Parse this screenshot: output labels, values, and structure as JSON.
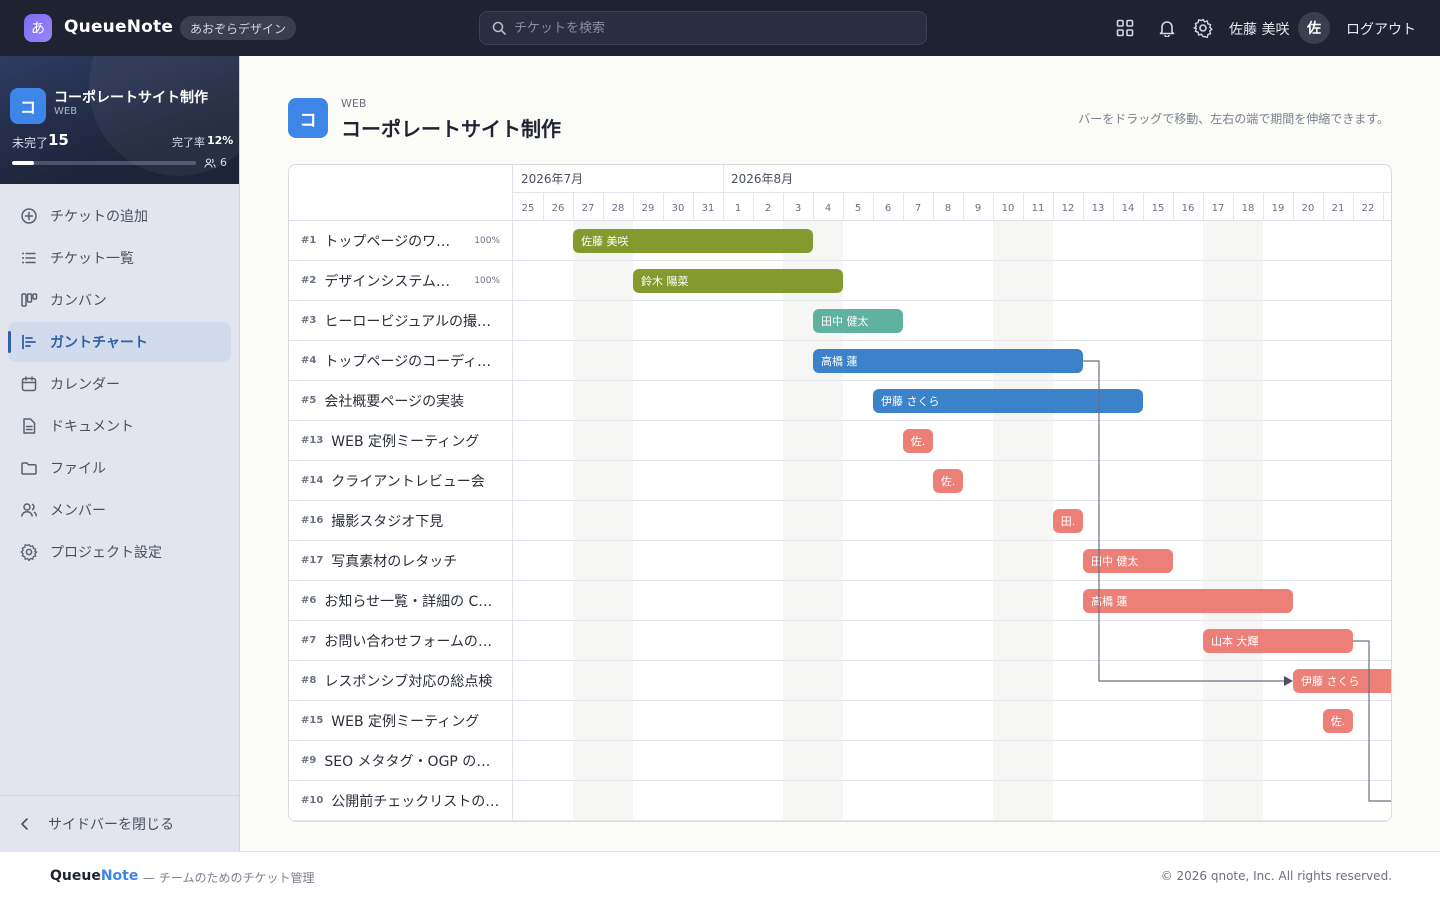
{
  "topbar": {
    "logo_glyph": "あ",
    "brand": "QueueNote",
    "org": "あおぞらデザイン",
    "search_placeholder": "チケットを検索",
    "user_name": "佐藤 美咲",
    "user_initial": "佐",
    "logout": "ログアウト",
    "icons": [
      "apps-grid-icon",
      "bell-icon",
      "gear-icon"
    ]
  },
  "project": {
    "icon": "コ",
    "name": "コーポレートサイト制作",
    "code": "WEB",
    "open_label": "未完了",
    "open_count": "15",
    "rate_label": "完了率",
    "rate": "12%",
    "progress": 0.12,
    "members": "6"
  },
  "nav": [
    {
      "label": "チケットの追加",
      "icon": "plus-circle-icon",
      "active": false
    },
    {
      "label": "チケット一覧",
      "icon": "list-icon",
      "active": false
    },
    {
      "label": "カンバン",
      "icon": "kanban-icon",
      "active": false
    },
    {
      "label": "ガントチャート",
      "icon": "gantt-icon",
      "active": true
    },
    {
      "label": "カレンダー",
      "icon": "calendar-icon",
      "active": false
    },
    {
      "label": "ドキュメント",
      "icon": "document-icon",
      "active": false
    },
    {
      "label": "ファイル",
      "icon": "folder-icon",
      "active": false
    },
    {
      "label": "メンバー",
      "icon": "users-icon",
      "active": false
    },
    {
      "label": "プロジェクト設定",
      "icon": "gear-icon",
      "active": false
    }
  ],
  "sidebar_close": "サイドバーを閉じる",
  "page": {
    "icon": "コ",
    "code": "WEB",
    "title": "コーポレートサイト制作",
    "hint": "バーをドラッグで移動、左右の端で期間を伸縮できます。"
  },
  "gantt": {
    "months": [
      {
        "label": "2026年7月",
        "start_index": 0
      },
      {
        "label": "2026年8月",
        "start_index": 7
      }
    ],
    "days": [
      "25",
      "26",
      "27",
      "28",
      "29",
      "30",
      "31",
      "1",
      "2",
      "3",
      "4",
      "5",
      "6",
      "7",
      "8",
      "9",
      "10",
      "11",
      "12",
      "13",
      "14",
      "15",
      "16",
      "17",
      "18",
      "19",
      "20",
      "21",
      "22"
    ],
    "weekend_indices": [
      2,
      9,
      16,
      23
    ],
    "tasks": [
      {
        "id": "#1",
        "name": "トップページのワイ…",
        "pct": "100%",
        "start": 2,
        "end": 10,
        "assignee": "佐藤 美咲",
        "color": "#849a2e"
      },
      {
        "id": "#2",
        "name": "デザインシステムの…",
        "pct": "100%",
        "start": 4,
        "end": 11,
        "assignee": "鈴木 陽菜",
        "color": "#849a2e"
      },
      {
        "id": "#3",
        "name": "ヒーロービジュアルの撮影…",
        "pct": "",
        "start": 10,
        "end": 13,
        "assignee": "田中 健太",
        "color": "#5fb2a0"
      },
      {
        "id": "#4",
        "name": "トップページのコーディン…",
        "pct": "",
        "start": 10,
        "end": 19,
        "assignee": "高橋 蓮",
        "color": "#3c82cb"
      },
      {
        "id": "#5",
        "name": "会社概要ページの実装",
        "pct": "",
        "start": 12,
        "end": 21,
        "assignee": "伊藤 さくら",
        "color": "#3c82cb"
      },
      {
        "id": "#13",
        "name": "WEB 定例ミーティング",
        "pct": "",
        "start": 13,
        "end": 14,
        "assignee": "佐.",
        "color": "#ec8078"
      },
      {
        "id": "#14",
        "name": "クライアントレビュー会",
        "pct": "",
        "start": 14,
        "end": 15,
        "assignee": "佐.",
        "color": "#ec8078"
      },
      {
        "id": "#16",
        "name": "撮影スタジオ下見",
        "pct": "",
        "start": 18,
        "end": 19,
        "assignee": "田.",
        "color": "#ec8078"
      },
      {
        "id": "#17",
        "name": "写真素材のレタッチ",
        "pct": "",
        "start": 19,
        "end": 22,
        "assignee": "田中 健太",
        "color": "#ec8078"
      },
      {
        "id": "#6",
        "name": "お知らせ一覧・詳細の CM…",
        "pct": "",
        "start": 19,
        "end": 26,
        "assignee": "高橋 蓮",
        "color": "#ec8078"
      },
      {
        "id": "#7",
        "name": "お問い合わせフォームの実…",
        "pct": "",
        "start": 23,
        "end": 28,
        "assignee": "山本 大輝",
        "color": "#ec8078"
      },
      {
        "id": "#8",
        "name": "レスポンシブ対応の総点検",
        "pct": "",
        "start": 26,
        "end": 30,
        "assignee": "伊藤 さくら",
        "color": "#ec8078"
      },
      {
        "id": "#15",
        "name": "WEB 定例ミーティング",
        "pct": "",
        "start": 27,
        "end": 28,
        "assignee": "佐.",
        "color": "#ec8078"
      },
      {
        "id": "#9",
        "name": "SEO メタタグ・OGP の整備",
        "pct": "",
        "start": null,
        "end": null,
        "assignee": "",
        "color": ""
      },
      {
        "id": "#10",
        "name": "公開前チェックリストの…",
        "pct": "",
        "start": null,
        "end": null,
        "assignee": "",
        "color": ""
      }
    ],
    "dependencies": [
      {
        "from": 3,
        "to": 11
      },
      {
        "from": 10,
        "to": 14
      }
    ]
  },
  "footer": {
    "brand_main": "Queue",
    "brand_accent": "Note",
    "tagline": "— チームのためのチケット管理",
    "copyright": "© 2026 qnote, Inc. All rights reserved."
  }
}
